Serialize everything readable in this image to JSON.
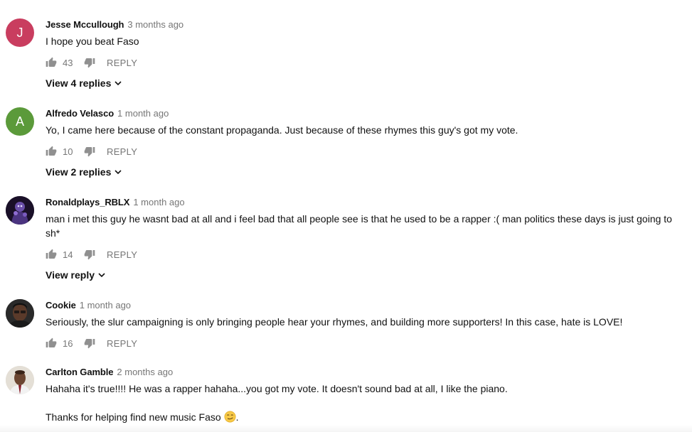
{
  "comments": [
    {
      "author": "Jesse Mccullough",
      "time": "3 months ago",
      "avatar_letter": "J",
      "avatar_color": "#c93d5f",
      "text": "I hope you beat Faso",
      "likes": "43",
      "reply_label": "REPLY",
      "view_replies": "View 4 replies"
    },
    {
      "author": "Alfredo Velasco",
      "time": "1 month ago",
      "avatar_letter": "A",
      "avatar_color": "#5b9a3a",
      "text": "Yo, I came here because of the constant propaganda. Just because of these rhymes this guy's got my vote.",
      "likes": "10",
      "reply_label": "REPLY",
      "view_replies": "View 2 replies"
    },
    {
      "author": "Ronaldplays_RBLX",
      "time": "1 month ago",
      "text": "man i met this guy he wasnt bad at all and i feel bad that all people see is that he used to be a rapper :( man politics these days is just going to sh*",
      "likes": "14",
      "reply_label": "REPLY",
      "view_replies": "View reply"
    },
    {
      "author": "Cookie",
      "time": "1 month ago",
      "text": "Seriously, the slur campaigning is only bringing people hear your rhymes, and building more supporters!  In this case, hate is LOVE!",
      "likes": "16",
      "reply_label": "REPLY"
    },
    {
      "author": "Carlton Gamble",
      "time": "2 months ago",
      "text_line1": "Hahaha it's true!!!! He was a rapper hahaha...you got my vote.  It doesn't sound bad at all, I like the piano.",
      "text_line2": "Thanks for helping find new music Faso",
      "text_line2_end": "."
    }
  ],
  "icons": {
    "like": "thumb-up-icon",
    "dislike": "thumb-down-icon",
    "expand": "chevron-down-icon",
    "emoji": "smirk-emoji"
  },
  "colors": {
    "muted": "#767676",
    "text": "#111111"
  }
}
